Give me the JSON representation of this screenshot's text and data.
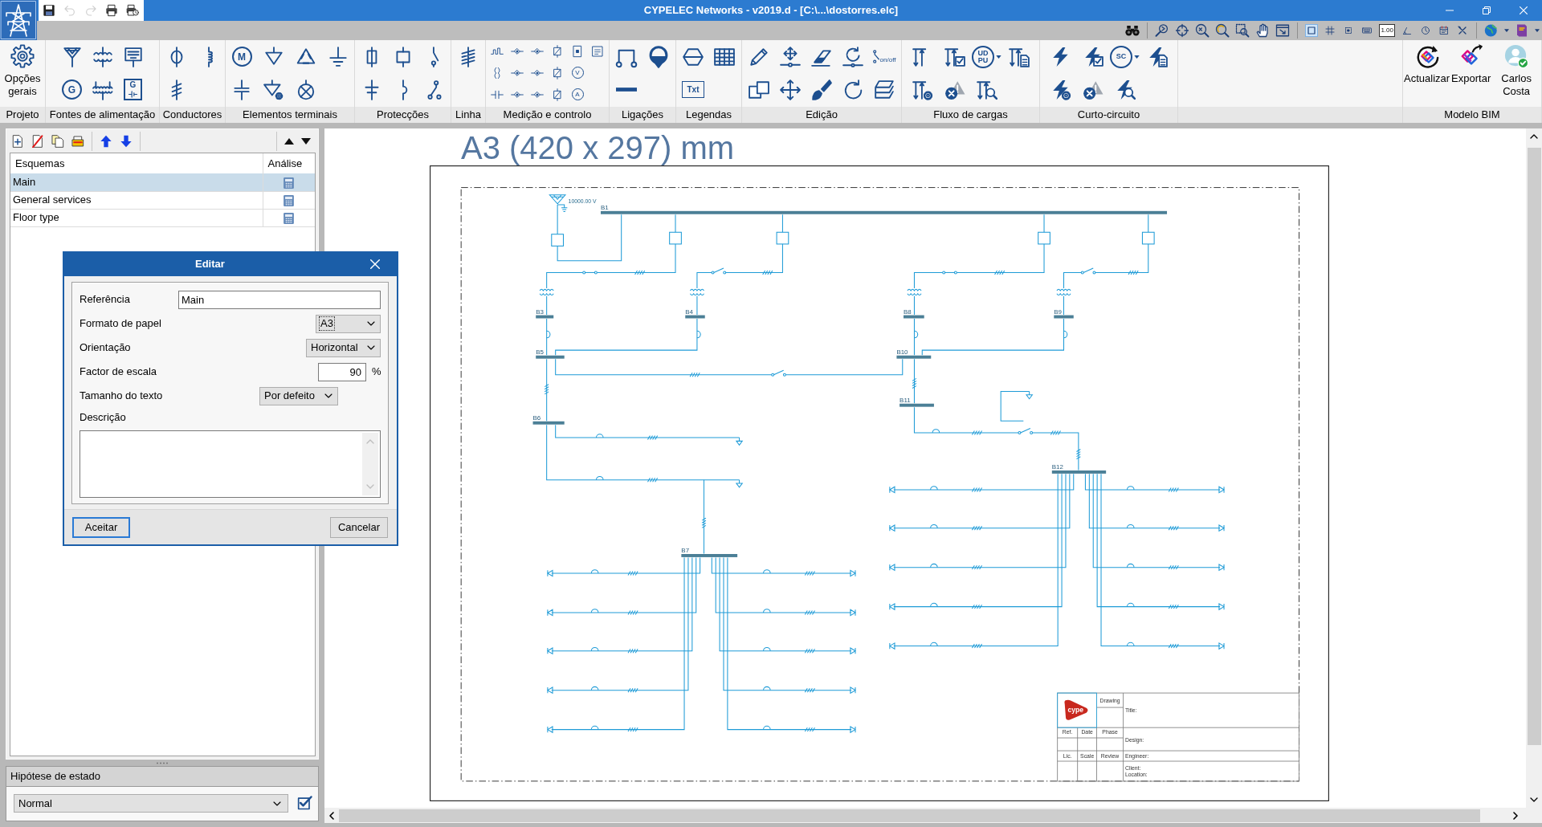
{
  "window": {
    "title": "CYPELEC Networks - v2019.d - [C:\\...\\dostorres.elc]"
  },
  "quick_access": [
    {
      "disabled": false
    },
    {
      "disabled": true
    },
    {
      "disabled": true
    },
    {
      "disabled": false
    },
    {
      "disabled": false
    }
  ],
  "display_toolbar": [
    {
      "on": true
    },
    {
      "on": false
    },
    {
      "on": false
    },
    {
      "on": false
    },
    {
      "label": "1.00",
      "on": false
    },
    {
      "on": false
    },
    {
      "on": false
    },
    {
      "on": false
    },
    {
      "on": false
    }
  ],
  "ribbon": {
    "groups": [
      {
        "label": "Projeto",
        "buttons": [
          {
            "label": "Opções gerais"
          }
        ]
      },
      {
        "label": "Fontes de alimentação",
        "tool_labels": [
          "G",
          "G"
        ]
      },
      {
        "label": "Conductores"
      },
      {
        "label": "Elementos terminais",
        "tool_labels": [
          "M"
        ]
      },
      {
        "label": "Protecções"
      },
      {
        "label": "Linha"
      },
      {
        "label": "Medição e controlo",
        "tool_labels": [
          "V",
          "A"
        ]
      },
      {
        "label": "Ligações"
      },
      {
        "label": "Legendas",
        "tool_labels": [
          "Txt"
        ]
      },
      {
        "label": "Edição",
        "tool_labels": [
          "on/off"
        ]
      },
      {
        "label": "Fluxo de cargas",
        "tool_labels": [
          "UD",
          "PU"
        ]
      },
      {
        "label": "Curto-circuito",
        "tool_labels": [
          "SC"
        ]
      },
      {
        "label": "Modelo BIM",
        "buttons": [
          {
            "label": "Actualizar"
          },
          {
            "label": "Exportar"
          },
          {
            "label": "Carlos Costa"
          }
        ]
      }
    ]
  },
  "schemes": {
    "columns": [
      "Esquemas",
      "Análise"
    ],
    "rows": [
      {
        "name": "Main",
        "selected": true
      },
      {
        "name": "General services",
        "selected": false
      },
      {
        "name": "Floor type",
        "selected": false
      }
    ]
  },
  "state_panel": {
    "title": "Hipótese de estado",
    "value": "Normal"
  },
  "dialog": {
    "title": "Editar",
    "fields": [
      {
        "kind": "text",
        "label": "Referência",
        "value": "Main",
        "focused": false
      },
      {
        "kind": "select",
        "label": "Formato de papel",
        "value": "A3",
        "focused": true
      },
      {
        "kind": "select",
        "label": "Orientação",
        "value": "Horizontal",
        "focused": false
      },
      {
        "kind": "number",
        "label": "Factor de escala",
        "value": "90",
        "unit": "%",
        "focused": false
      },
      {
        "kind": "select",
        "label": "Tamanho do texto",
        "value": "Por defeito",
        "focused": false
      },
      {
        "kind": "textarea",
        "label": "Descrição",
        "focused": false
      }
    ],
    "buttons": [
      {
        "label": "Aceitar",
        "default": true
      },
      {
        "label": "Cancelar",
        "default": false
      }
    ]
  },
  "canvas": {
    "title": "A3 (420 x 297) mm",
    "schematic": {
      "source_voltage": "10000.00 V",
      "bus_labels": [
        "B1",
        "B3",
        "B4",
        "B5",
        "B6",
        "B7",
        "B8",
        "B9",
        "B10",
        "B11",
        "B12"
      ]
    },
    "title_block": {
      "logo": "cype",
      "drawing": "Drawing",
      "title": "Title:",
      "ref": "Ref.",
      "date": "Date",
      "phase": "Phase",
      "design": "Design:",
      "lic": "Lic.",
      "scale": "Scale",
      "review": "Review",
      "engineer": "Engineer:",
      "client": "Client:",
      "location": "Location:"
    }
  }
}
